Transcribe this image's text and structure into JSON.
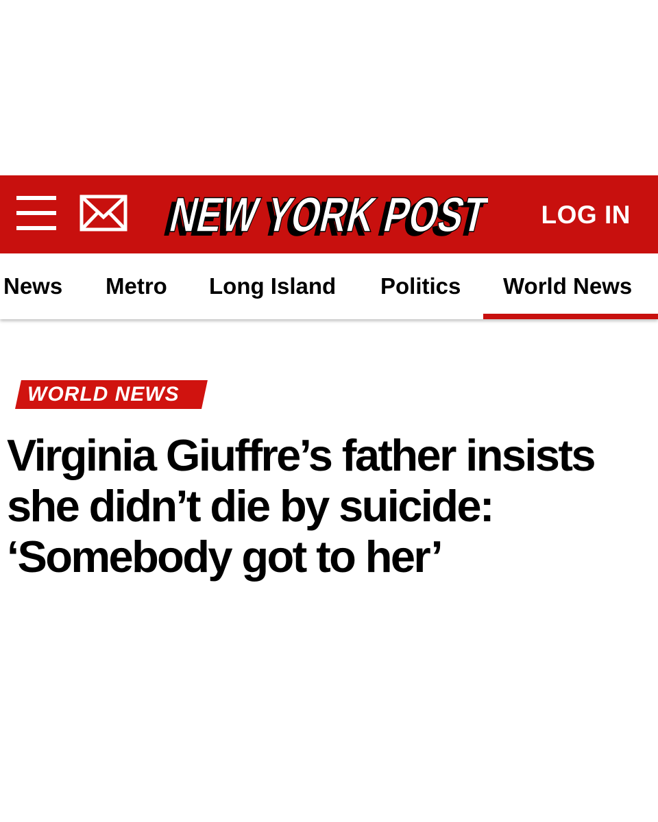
{
  "header": {
    "menu_icon": "hamburger-menu-icon",
    "mail_icon": "envelope-icon",
    "logo_text": "NEW YORK POST",
    "login_label": "LOG IN",
    "colors": {
      "brand_red": "#c8100e",
      "text_on_red": "#ffffff"
    }
  },
  "nav": {
    "items": [
      {
        "label": "News"
      },
      {
        "label": "Metro"
      },
      {
        "label": "Long Island"
      },
      {
        "label": "Politics"
      },
      {
        "label": "World News",
        "active": true
      }
    ]
  },
  "article": {
    "section_tag": "WORLD NEWS",
    "headline": "Virginia Giuffre’s father insists she didn’t die by suicide: ‘Somebody got to her’"
  }
}
